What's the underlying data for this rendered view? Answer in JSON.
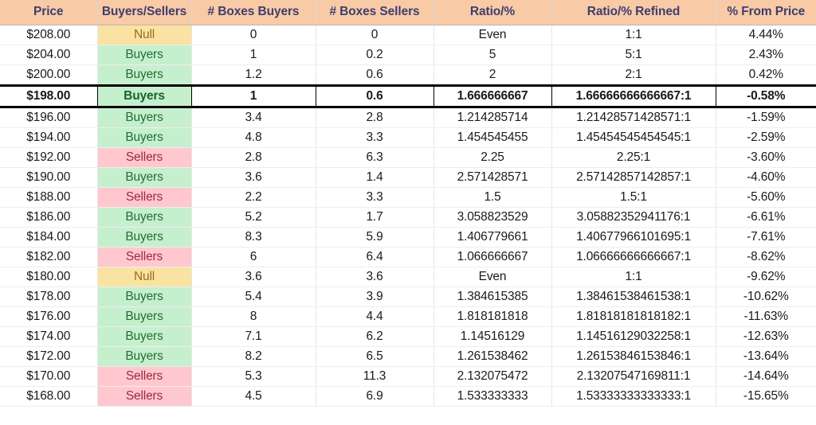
{
  "table": {
    "columns": [
      {
        "key": "price",
        "label": "Price"
      },
      {
        "key": "side",
        "label": "Buyers/Sellers"
      },
      {
        "key": "boxes_buy",
        "label": "# Boxes Buyers"
      },
      {
        "key": "boxes_sell",
        "label": "# Boxes Sellers"
      },
      {
        "key": "ratio",
        "label": "Ratio/%"
      },
      {
        "key": "refined",
        "label": "Ratio/% Refined"
      },
      {
        "key": "from_price",
        "label": "% From Price"
      }
    ],
    "colors": {
      "header_bg": "#F8CBA6",
      "header_text": "#3F3D6E",
      "buyers_bg": "#C6EFCE",
      "buyers_text": "#206F35",
      "sellers_bg": "#FFC7CE",
      "sellers_text": "#9C2A42",
      "null_bg": "#FAE3A2",
      "null_text": "#9A6B1A",
      "highlight_border": "#000000"
    },
    "rows": [
      {
        "price": "$208.00",
        "side": "Null",
        "side_state": "null",
        "boxes_buy": "0",
        "boxes_sell": "0",
        "ratio": "Even",
        "refined": "1:1",
        "from_price": "4.44%",
        "highlight": false
      },
      {
        "price": "$204.00",
        "side": "Buyers",
        "side_state": "buyers",
        "boxes_buy": "1",
        "boxes_sell": "0.2",
        "ratio": "5",
        "refined": "5:1",
        "from_price": "2.43%",
        "highlight": false
      },
      {
        "price": "$200.00",
        "side": "Buyers",
        "side_state": "buyers",
        "boxes_buy": "1.2",
        "boxes_sell": "0.6",
        "ratio": "2",
        "refined": "2:1",
        "from_price": "0.42%",
        "highlight": false
      },
      {
        "price": "$198.00",
        "side": "Buyers",
        "side_state": "buyers",
        "boxes_buy": "1",
        "boxes_sell": "0.6",
        "ratio": "1.666666667",
        "refined": "1.66666666666667:1",
        "from_price": "-0.58%",
        "highlight": true
      },
      {
        "price": "$196.00",
        "side": "Buyers",
        "side_state": "buyers",
        "boxes_buy": "3.4",
        "boxes_sell": "2.8",
        "ratio": "1.214285714",
        "refined": "1.21428571428571:1",
        "from_price": "-1.59%",
        "highlight": false
      },
      {
        "price": "$194.00",
        "side": "Buyers",
        "side_state": "buyers",
        "boxes_buy": "4.8",
        "boxes_sell": "3.3",
        "ratio": "1.454545455",
        "refined": "1.45454545454545:1",
        "from_price": "-2.59%",
        "highlight": false
      },
      {
        "price": "$192.00",
        "side": "Sellers",
        "side_state": "sellers",
        "boxes_buy": "2.8",
        "boxes_sell": "6.3",
        "ratio": "2.25",
        "refined": "2.25:1",
        "from_price": "-3.60%",
        "highlight": false
      },
      {
        "price": "$190.00",
        "side": "Buyers",
        "side_state": "buyers",
        "boxes_buy": "3.6",
        "boxes_sell": "1.4",
        "ratio": "2.571428571",
        "refined": "2.57142857142857:1",
        "from_price": "-4.60%",
        "highlight": false
      },
      {
        "price": "$188.00",
        "side": "Sellers",
        "side_state": "sellers",
        "boxes_buy": "2.2",
        "boxes_sell": "3.3",
        "ratio": "1.5",
        "refined": "1.5:1",
        "from_price": "-5.60%",
        "highlight": false
      },
      {
        "price": "$186.00",
        "side": "Buyers",
        "side_state": "buyers",
        "boxes_buy": "5.2",
        "boxes_sell": "1.7",
        "ratio": "3.058823529",
        "refined": "3.05882352941176:1",
        "from_price": "-6.61%",
        "highlight": false
      },
      {
        "price": "$184.00",
        "side": "Buyers",
        "side_state": "buyers",
        "boxes_buy": "8.3",
        "boxes_sell": "5.9",
        "ratio": "1.406779661",
        "refined": "1.40677966101695:1",
        "from_price": "-7.61%",
        "highlight": false
      },
      {
        "price": "$182.00",
        "side": "Sellers",
        "side_state": "sellers",
        "boxes_buy": "6",
        "boxes_sell": "6.4",
        "ratio": "1.066666667",
        "refined": "1.06666666666667:1",
        "from_price": "-8.62%",
        "highlight": false
      },
      {
        "price": "$180.00",
        "side": "Null",
        "side_state": "null",
        "boxes_buy": "3.6",
        "boxes_sell": "3.6",
        "ratio": "Even",
        "refined": "1:1",
        "from_price": "-9.62%",
        "highlight": false
      },
      {
        "price": "$178.00",
        "side": "Buyers",
        "side_state": "buyers",
        "boxes_buy": "5.4",
        "boxes_sell": "3.9",
        "ratio": "1.384615385",
        "refined": "1.38461538461538:1",
        "from_price": "-10.62%",
        "highlight": false
      },
      {
        "price": "$176.00",
        "side": "Buyers",
        "side_state": "buyers",
        "boxes_buy": "8",
        "boxes_sell": "4.4",
        "ratio": "1.818181818",
        "refined": "1.81818181818182:1",
        "from_price": "-11.63%",
        "highlight": false
      },
      {
        "price": "$174.00",
        "side": "Buyers",
        "side_state": "buyers",
        "boxes_buy": "7.1",
        "boxes_sell": "6.2",
        "ratio": "1.14516129",
        "refined": "1.14516129032258:1",
        "from_price": "-12.63%",
        "highlight": false
      },
      {
        "price": "$172.00",
        "side": "Buyers",
        "side_state": "buyers",
        "boxes_buy": "8.2",
        "boxes_sell": "6.5",
        "ratio": "1.261538462",
        "refined": "1.26153846153846:1",
        "from_price": "-13.64%",
        "highlight": false
      },
      {
        "price": "$170.00",
        "side": "Sellers",
        "side_state": "sellers",
        "boxes_buy": "5.3",
        "boxes_sell": "11.3",
        "ratio": "2.132075472",
        "refined": "2.13207547169811:1",
        "from_price": "-14.64%",
        "highlight": false
      },
      {
        "price": "$168.00",
        "side": "Sellers",
        "side_state": "sellers",
        "boxes_buy": "4.5",
        "boxes_sell": "6.9",
        "ratio": "1.533333333",
        "refined": "1.53333333333333:1",
        "from_price": "-15.65%",
        "highlight": false
      }
    ]
  }
}
